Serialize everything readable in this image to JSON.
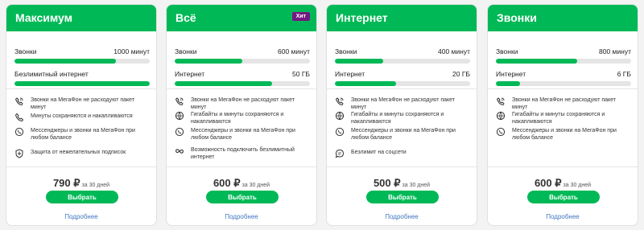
{
  "colors": {
    "brand_green": "#00b956",
    "badge_purple": "#731982",
    "link_blue": "#4077c2"
  },
  "cards": [
    {
      "title": "Максимум",
      "badge": "",
      "stats": [
        {
          "label": "Звонки",
          "value": "1000 минут",
          "fill": 0.75
        },
        {
          "label": "Безлимитный интернет",
          "value": "",
          "fill": 1.0
        }
      ],
      "features": [
        {
          "icon": "signal-phone-icon",
          "text": "Звонки на МегаФон не расходуют пакет минут"
        },
        {
          "icon": "phone-icon",
          "text": "Минуты сохраняются и накапливаются"
        },
        {
          "icon": "chat-phone-icon",
          "text": "Мессенджеры и звонки на МегаФон при любом балансе"
        },
        {
          "icon": "shield-icon",
          "text": "Защита от нежелательных подписок"
        }
      ],
      "price": "790 ₽",
      "period": "за 30 дней",
      "button": "Выбрать",
      "more": "Подробнее"
    },
    {
      "title": "Всё",
      "badge": "Хит",
      "stats": [
        {
          "label": "Звонки",
          "value": "600 минут",
          "fill": 0.5
        },
        {
          "label": "Интернет",
          "value": "50 ГБ",
          "fill": 0.72
        }
      ],
      "features": [
        {
          "icon": "signal-phone-icon",
          "text": "Звонки на МегаФон не расходуют пакет минут"
        },
        {
          "icon": "globe-phone-icon",
          "text": "Гигабайты и минуты сохраняются и накапливаются"
        },
        {
          "icon": "chat-phone-icon",
          "text": "Мессенджеры и звонки на МегаФон при любом балансе"
        },
        {
          "icon": "infinity-icon",
          "text": "Возможность подключить безлимитный интернет"
        }
      ],
      "price": "600 ₽",
      "period": "за 30 дней",
      "button": "Выбрать",
      "more": "Подробнее"
    },
    {
      "title": "Интернет",
      "badge": "",
      "stats": [
        {
          "label": "Звонки",
          "value": "400 минут",
          "fill": 0.36
        },
        {
          "label": "Интернет",
          "value": "20 ГБ",
          "fill": 0.45
        }
      ],
      "features": [
        {
          "icon": "signal-phone-icon",
          "text": "Звонки на МегаФон не расходуют пакет минут"
        },
        {
          "icon": "globe-phone-icon",
          "text": "Гигабайты и минуты сохраняются и накапливаются"
        },
        {
          "icon": "chat-phone-icon",
          "text": "Мессенджеры и звонки на МегаФон при любом балансе"
        },
        {
          "icon": "chat-bubble-icon",
          "text": "Безлимит на соцсети"
        }
      ],
      "price": "500 ₽",
      "period": "за 30 дней",
      "button": "Выбрать",
      "more": "Подробнее"
    },
    {
      "title": "Звонки",
      "badge": "",
      "stats": [
        {
          "label": "Звонки",
          "value": "800 минут",
          "fill": 0.6
        },
        {
          "label": "Интернет",
          "value": "6 ГБ",
          "fill": 0.18
        }
      ],
      "features": [
        {
          "icon": "signal-phone-icon",
          "text": "Звонки на МегаФон не расходуют пакет минут"
        },
        {
          "icon": "globe-phone-icon",
          "text": "Гигабайты и минуты сохраняются и накапливаются"
        },
        {
          "icon": "chat-phone-icon",
          "text": "Мессенджеры и звонки на МегаФон при любом балансе"
        }
      ],
      "price": "600 ₽",
      "period": "за 30 дней",
      "button": "Выбрать",
      "more": "Подробнее"
    }
  ]
}
